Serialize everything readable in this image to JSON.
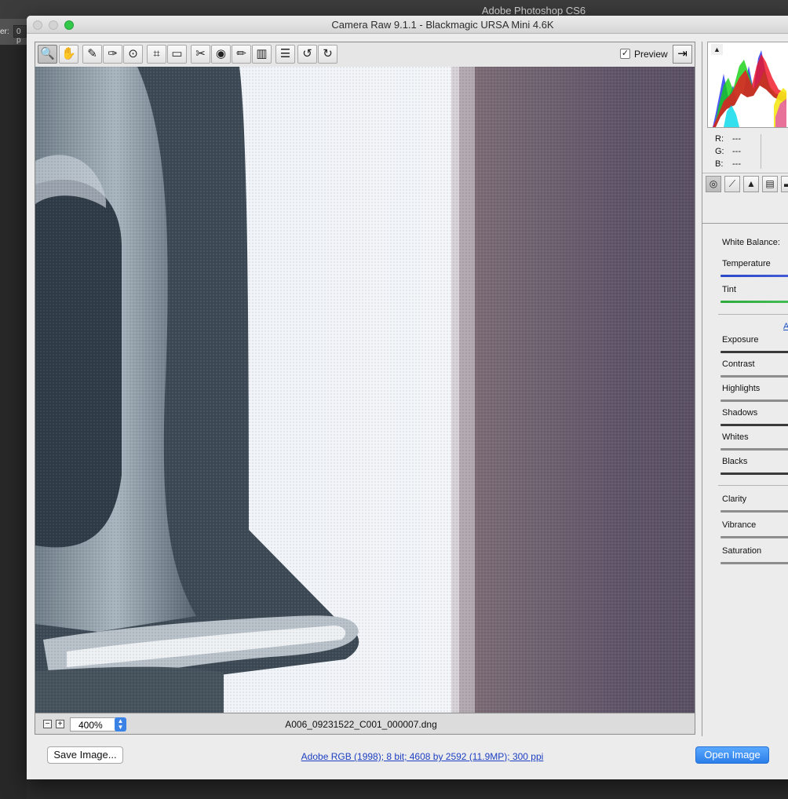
{
  "photoshop": {
    "app_title": "Adobe Photoshop CS6",
    "option_label": "er:",
    "option_value": "0 p"
  },
  "window": {
    "title": "Camera Raw 9.1.1  -  Blackmagic URSA Mini 4.6K"
  },
  "toolbar": {
    "tools": [
      {
        "name": "zoom-tool",
        "icon": "magnifier-icon",
        "glyph": "🔍"
      },
      {
        "name": "hand-tool",
        "icon": "hand-icon",
        "glyph": "✋"
      },
      {
        "name": "white-balance-tool",
        "icon": "eyedropper-icon",
        "glyph": "✎"
      },
      {
        "name": "color-sampler-tool",
        "icon": "color-sampler-icon",
        "glyph": "✑"
      },
      {
        "name": "targeted-adjustment-tool",
        "icon": "targeted-adjustment-icon",
        "glyph": "⊙"
      },
      {
        "name": "crop-tool",
        "icon": "crop-icon",
        "glyph": "⌗"
      },
      {
        "name": "straighten-tool",
        "icon": "straighten-icon",
        "glyph": "▭"
      },
      {
        "name": "spot-removal-tool",
        "icon": "spot-removal-icon",
        "glyph": "✂"
      },
      {
        "name": "red-eye-tool",
        "icon": "eye-icon",
        "glyph": "◉"
      },
      {
        "name": "adjustment-brush-tool",
        "icon": "brush-icon",
        "glyph": "✏"
      },
      {
        "name": "graduated-filter-tool",
        "icon": "graduated-filter-icon",
        "glyph": "▥"
      },
      {
        "name": "preferences-tool",
        "icon": "list-icon",
        "glyph": "☰"
      },
      {
        "name": "rotate-ccw-tool",
        "icon": "rotate-left-icon",
        "glyph": "↺"
      },
      {
        "name": "rotate-cw-tool",
        "icon": "rotate-right-icon",
        "glyph": "↻"
      }
    ],
    "preview_checked": "✓",
    "preview_label": "Preview",
    "fullscreen_glyph": "⇥"
  },
  "statusbar": {
    "zoom_out": "−",
    "zoom_in": "+",
    "zoom_value": "400%",
    "stepper_up": "▲",
    "stepper_down": "▼",
    "filename": "A006_09231522_C001_000007.dng"
  },
  "histogram": {
    "clip_glyph": "▲",
    "r_label": "R:",
    "g_label": "G:",
    "b_label": "B:",
    "r_value": "---",
    "g_value": "---",
    "b_value": "---"
  },
  "panel_tabs": [
    {
      "name": "tab-basic",
      "icon": "aperture-icon",
      "glyph": "◎"
    },
    {
      "name": "tab-tone-curve",
      "icon": "curve-icon",
      "glyph": "⟋"
    },
    {
      "name": "tab-detail",
      "icon": "triangle-icon",
      "glyph": "▲"
    },
    {
      "name": "tab-hsl",
      "icon": "hsl-icon",
      "glyph": "▤"
    },
    {
      "name": "tab-split-toning",
      "icon": "split-toning-icon",
      "glyph": "▬"
    }
  ],
  "basic_panel": {
    "white_balance_label": "White Balance:",
    "auto_label": "A",
    "controls": [
      {
        "label": "Temperature",
        "style": "temp"
      },
      {
        "label": "Tint",
        "style": "tint"
      },
      {
        "label": "Exposure",
        "style": "dark"
      },
      {
        "label": "Contrast",
        "style": "grey"
      },
      {
        "label": "Highlights",
        "style": "grey"
      },
      {
        "label": "Shadows",
        "style": "dark"
      },
      {
        "label": "Whites",
        "style": "grey"
      },
      {
        "label": "Blacks",
        "style": "dark"
      },
      {
        "label": "Clarity",
        "style": "grey"
      },
      {
        "label": "Vibrance",
        "style": "grey"
      },
      {
        "label": "Saturation",
        "style": "grey"
      }
    ]
  },
  "footer": {
    "save_label": "Save Image...",
    "workflow_options": "Adobe RGB (1998); 8 bit; 4608 by 2592 (11.9MP); 300 ppi",
    "open_label": "Open Image"
  }
}
